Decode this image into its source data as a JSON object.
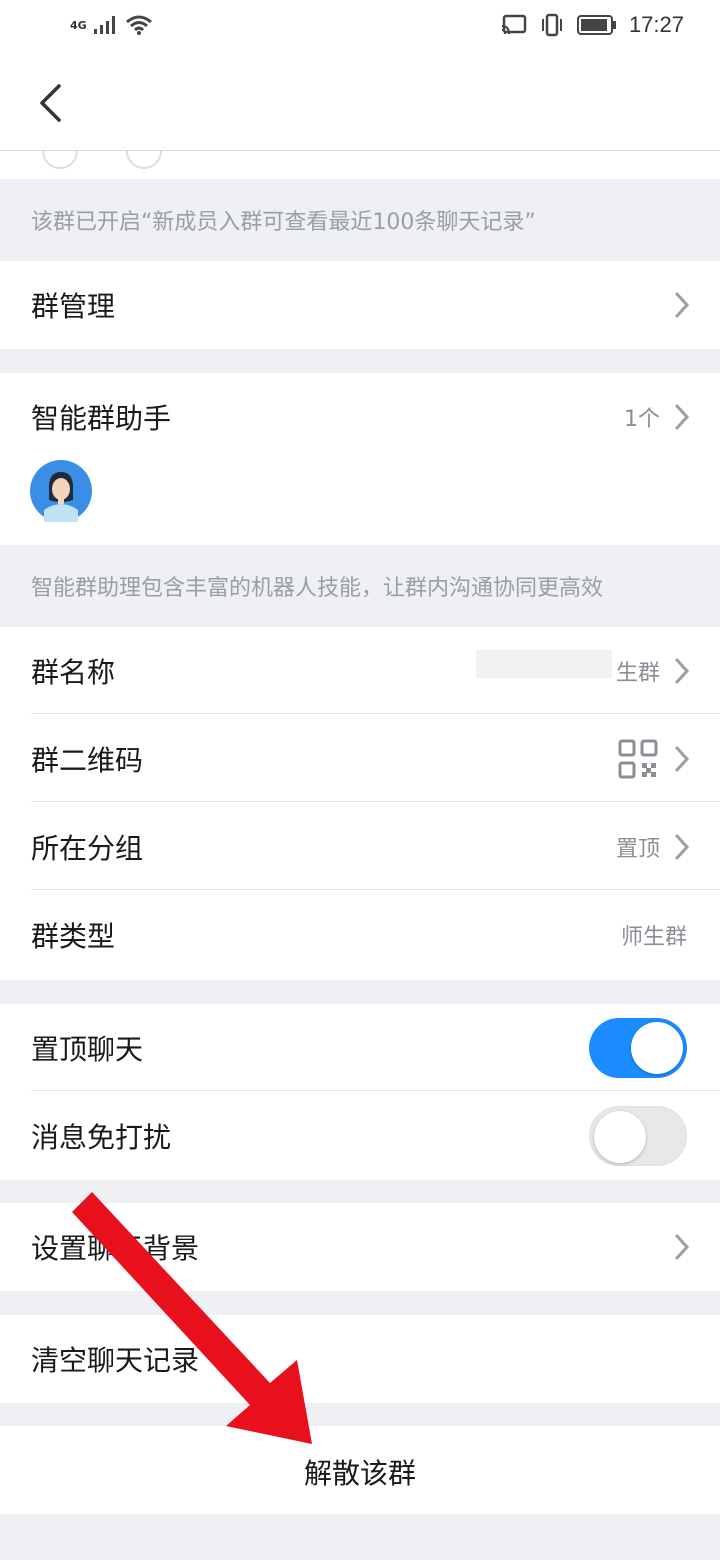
{
  "status_bar": {
    "network": "4G",
    "time": "17:27",
    "icons": [
      "signal-icon",
      "wifi-icon",
      "cast-icon",
      "vibrate-icon",
      "battery-icon"
    ]
  },
  "nav": {
    "back_icon": "back-chevron-icon"
  },
  "notice_history": "该群已开启“新成员入群可查看最近100条聊天记录”",
  "group_manage": {
    "label": "群管理"
  },
  "assistant": {
    "label": "智能群助手",
    "count": "1个",
    "note": "智能群助理包含丰富的机器人技能，让群内沟通协同更高效"
  },
  "info": {
    "name_label": "群名称",
    "name_value": "生群",
    "qrcode_label": "群二维码",
    "group_label": "所在分组",
    "group_value": "置顶",
    "type_label": "群类型",
    "type_value": "师生群"
  },
  "toggles": {
    "pin_label": "置顶聊天",
    "pin_on": true,
    "mute_label": "消息免打扰",
    "mute_on": false
  },
  "background": {
    "label": "设置聊天背景"
  },
  "clear": {
    "label": "清空聊天记录"
  },
  "dissolve": {
    "label": "解散该群"
  },
  "colors": {
    "accent": "#1a8cff",
    "annotation_arrow": "#e8101c",
    "page_bg": "#eef0f3"
  }
}
